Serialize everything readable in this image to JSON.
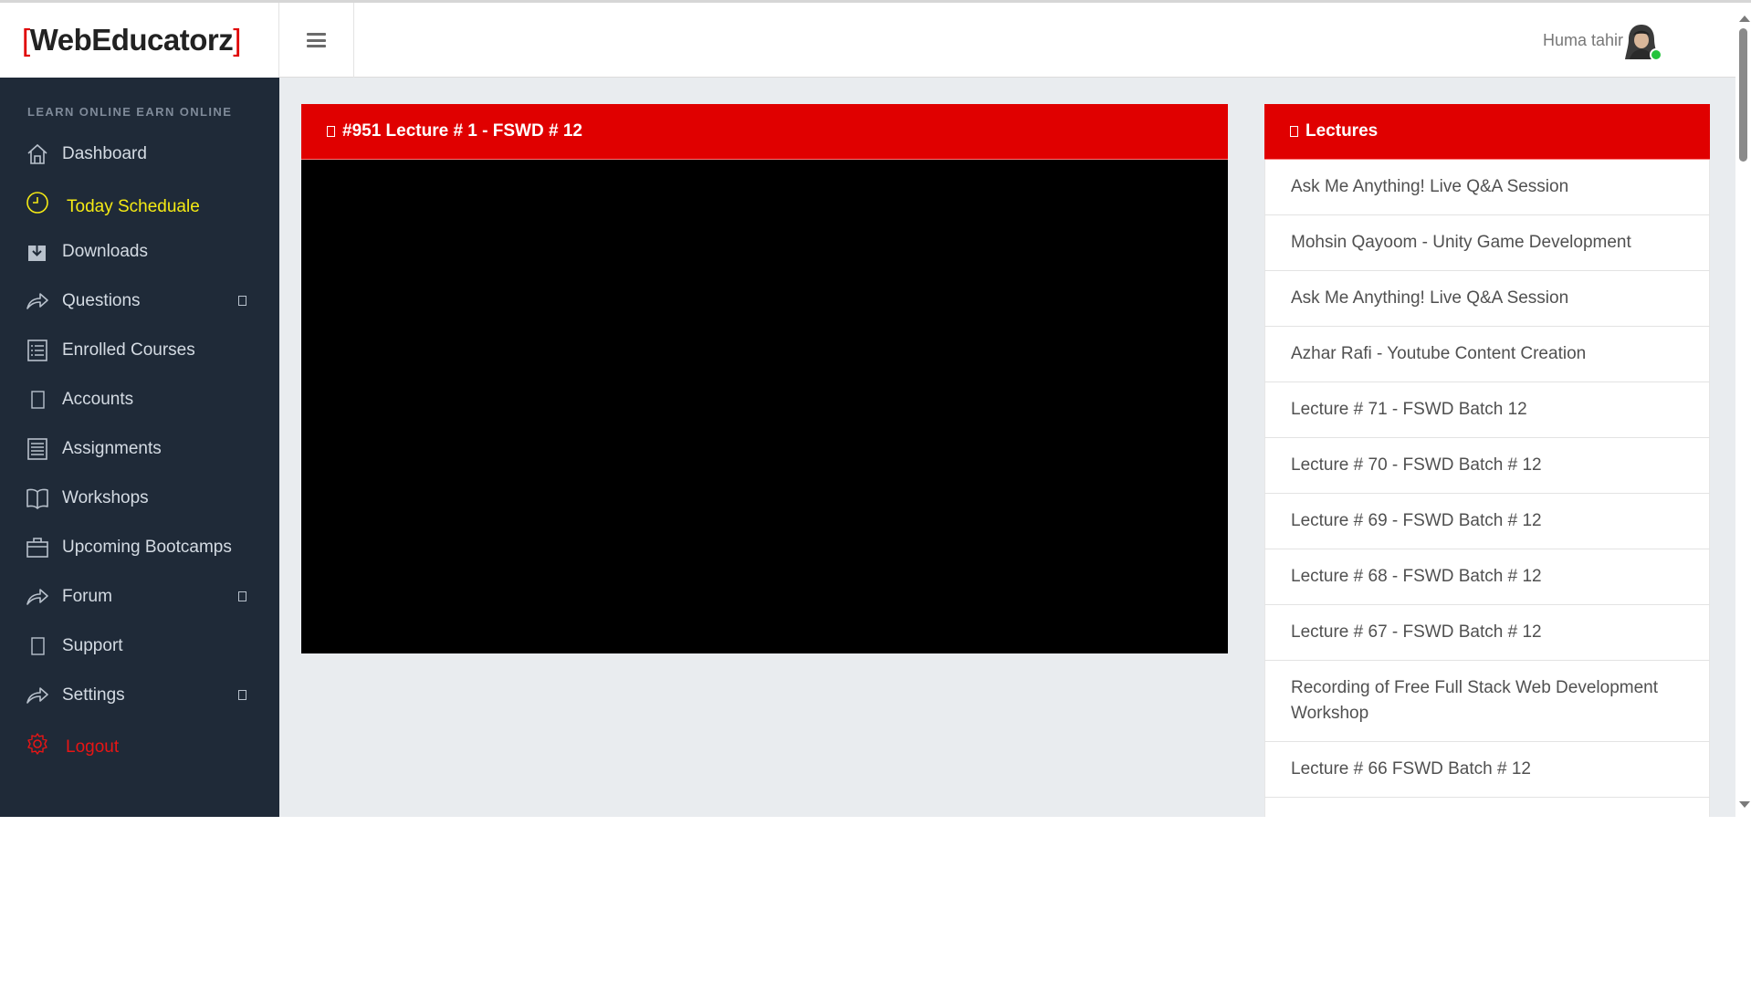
{
  "brand": {
    "bracket_open": "[",
    "name": "WebEducatorz",
    "bracket_close": "]",
    "accent": "#e00000"
  },
  "header": {
    "user_name": "Huma tahir",
    "menu_icon": "hamburger-icon",
    "avatar_icon": "user-avatar",
    "status": "online"
  },
  "sidebar": {
    "tagline": "LEARN ONLINE EARN ONLINE",
    "items": [
      {
        "label": "Dashboard",
        "icon": "home-icon"
      },
      {
        "label": "Today Scheduale",
        "icon": "clock-icon",
        "active": true
      },
      {
        "label": "Downloads",
        "icon": "download-icon"
      },
      {
        "label": "Questions",
        "icon": "share-arrow-icon",
        "has_submenu": true
      },
      {
        "label": "Enrolled Courses",
        "icon": "list-icon"
      },
      {
        "label": "Accounts",
        "icon": "square-icon"
      },
      {
        "label": "Assignments",
        "icon": "document-icon"
      },
      {
        "label": "Workshops",
        "icon": "book-icon"
      },
      {
        "label": "Upcoming Bootcamps",
        "icon": "briefcase-icon"
      },
      {
        "label": "Forum",
        "icon": "share-arrow-icon",
        "has_submenu": true
      },
      {
        "label": "Support",
        "icon": "square-icon"
      },
      {
        "label": "Settings",
        "icon": "share-arrow-icon",
        "has_submenu": true
      },
      {
        "label": "Logout",
        "icon": "gear-icon"
      }
    ]
  },
  "video_card": {
    "title": "#951 Lecture # 1 - FSWD # 12",
    "icon": "square-icon"
  },
  "lectures_card": {
    "title": "Lectures",
    "icon": "square-icon",
    "items": [
      "Ask Me Anything! Live Q&A Session",
      "Mohsin Qayoom - Unity Game Development",
      "Ask Me Anything! Live Q&A Session",
      "Azhar Rafi - Youtube Content Creation",
      "Lecture # 71 - FSWD Batch 12",
      "Lecture # 70 - FSWD Batch # 12",
      "Lecture # 69 - FSWD Batch # 12",
      "Lecture # 68 - FSWD Batch # 12",
      "Lecture # 67 - FSWD Batch # 12",
      "Recording of Free Full Stack Web Development Workshop",
      "Lecture # 66 FSWD Batch # 12"
    ]
  },
  "colors": {
    "sidebar_bg": "#1f2a38",
    "card_header": "#e00000",
    "active_item": "#f5ea14",
    "logout": "#e81515",
    "content_bg": "#e9ecef"
  }
}
